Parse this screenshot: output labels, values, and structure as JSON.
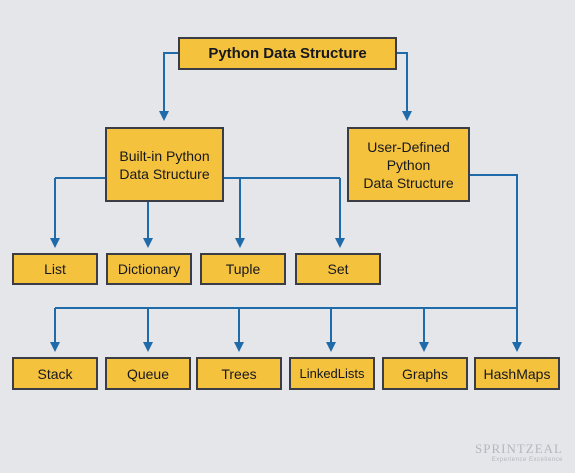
{
  "root": {
    "label": "Python Data Structure"
  },
  "builtin": {
    "lines": [
      "Built-in Python",
      "Data Structure"
    ]
  },
  "userdef": {
    "lines": [
      "User-Defined",
      "Python",
      "Data Structure"
    ]
  },
  "builtin_children": [
    "List",
    "Dictionary",
    "Tuple",
    "Set"
  ],
  "userdef_children": [
    "Stack",
    "Queue",
    "Trees",
    "LinkedLists",
    "Graphs",
    "HashMaps"
  ],
  "watermark": {
    "main": "SPRINTZEAL",
    "sub": "Experience Excellence"
  },
  "colors": {
    "box_fill": "#f5c23e",
    "box_border": "#3a3d45",
    "connector": "#1f6aa8",
    "background": "#e5e6ea"
  }
}
